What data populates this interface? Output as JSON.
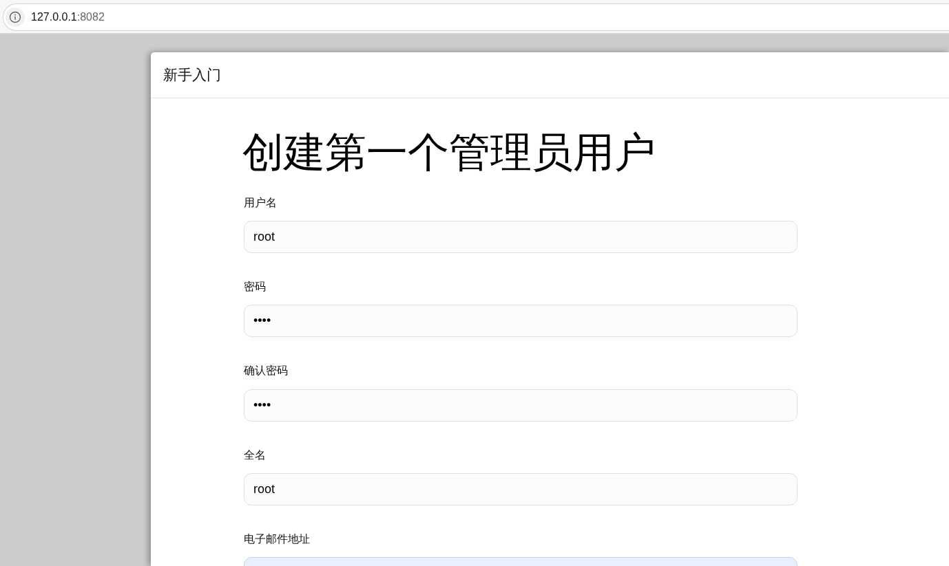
{
  "browser": {
    "address_bar": {
      "host": "127.0.0.1",
      "port": ":8082"
    }
  },
  "dialog": {
    "title": "新手入门"
  },
  "form": {
    "heading": "创建第一个管理员用户",
    "fields": [
      {
        "label": "用户名",
        "value": "root",
        "autofilled": false
      },
      {
        "label": "密码",
        "value": "••••",
        "autofilled": false
      },
      {
        "label": "确认密码",
        "value": "••••",
        "autofilled": false
      },
      {
        "label": "全名",
        "value": "root",
        "autofilled": false
      },
      {
        "label": "电子邮件地址",
        "autofilled": true
      }
    ]
  }
}
